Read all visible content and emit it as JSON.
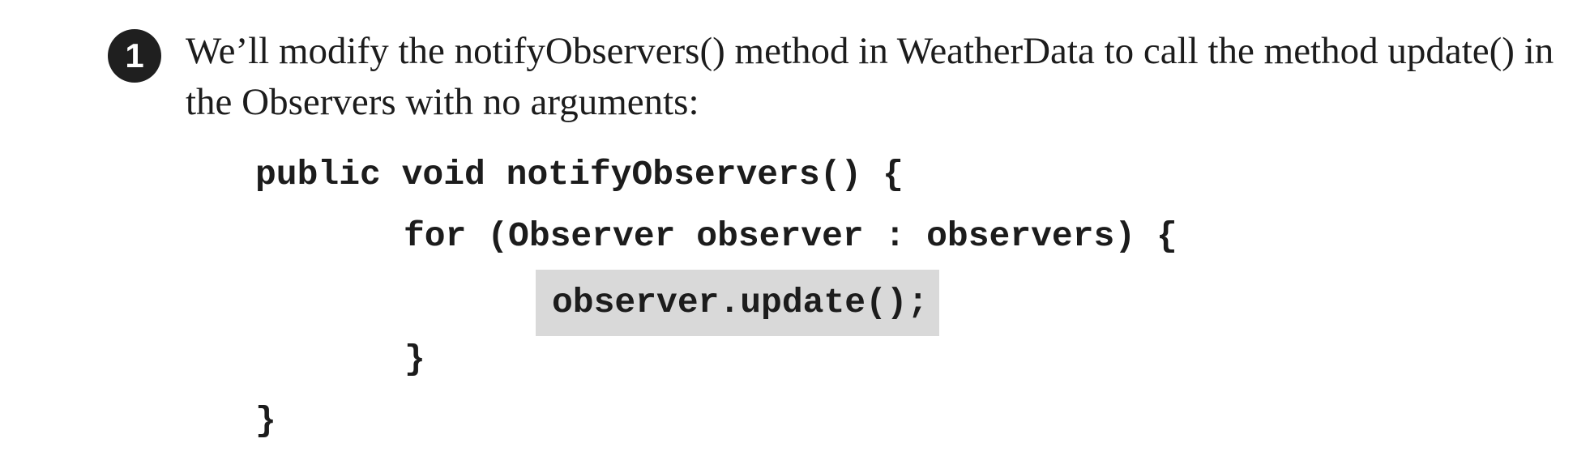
{
  "step": {
    "number": "1",
    "text": "We’ll modify the notifyObservers() method in WeatherData to call the method update() in the Observers with no arguments:"
  },
  "code": {
    "lines": [
      "public void notifyObservers() {",
      "for (Observer observer : observers) {",
      "observer.update();",
      "}",
      "}"
    ],
    "highlight_color": "#d9d9d9"
  }
}
